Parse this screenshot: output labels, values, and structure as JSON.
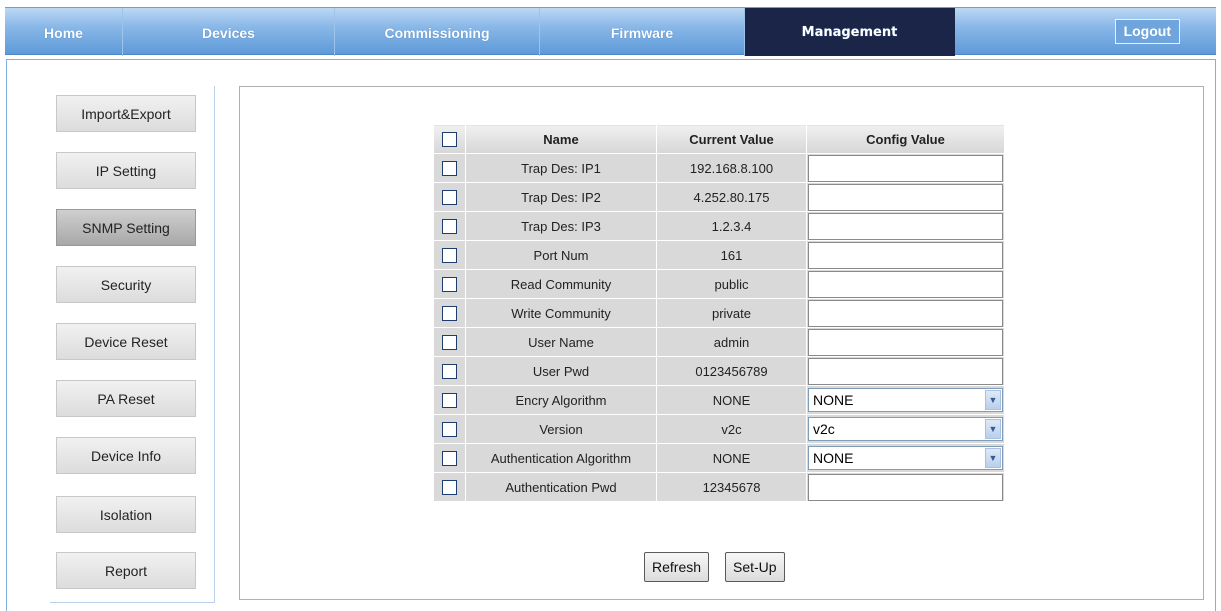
{
  "nav": {
    "tabs": [
      {
        "label": "Home"
      },
      {
        "label": "Devices"
      },
      {
        "label": "Commissioning"
      },
      {
        "label": "Firmware"
      },
      {
        "label": "Management"
      }
    ],
    "logout_label": "Logout"
  },
  "sidebar": {
    "items": [
      {
        "label": "Import&Export"
      },
      {
        "label": "IP Setting"
      },
      {
        "label": "SNMP Setting"
      },
      {
        "label": "Security"
      },
      {
        "label": "Device Reset"
      },
      {
        "label": "PA Reset"
      },
      {
        "label": "Device Info"
      },
      {
        "label": "Isolation"
      },
      {
        "label": "Report"
      }
    ]
  },
  "table": {
    "headers": {
      "name": "Name",
      "current": "Current Value",
      "config": "Config Value"
    },
    "rows": [
      {
        "name": "Trap Des: IP1",
        "current": "192.168.8.100",
        "config": ""
      },
      {
        "name": "Trap Des: IP2",
        "current": "4.252.80.175",
        "config": ""
      },
      {
        "name": "Trap Des: IP3",
        "current": "1.2.3.4",
        "config": ""
      },
      {
        "name": "Port Num",
        "current": "161",
        "config": ""
      },
      {
        "name": "Read Community",
        "current": "public",
        "config": ""
      },
      {
        "name": "Write Community",
        "current": "private",
        "config": ""
      },
      {
        "name": "User Name",
        "current": "admin",
        "config": ""
      },
      {
        "name": "User Pwd",
        "current": "0123456789",
        "config": ""
      },
      {
        "name": "Encry Algorithm",
        "current": "NONE",
        "config": "NONE"
      },
      {
        "name": "Version",
        "current": "v2c",
        "config": "v2c"
      },
      {
        "name": "Authentication Algorithm",
        "current": "NONE",
        "config": "NONE"
      },
      {
        "name": "Authentication Pwd",
        "current": "12345678",
        "config": ""
      }
    ]
  },
  "buttons": {
    "refresh": "Refresh",
    "setup": "Set-Up"
  },
  "icons": {
    "select_arrow": "chevron-down-icon"
  }
}
